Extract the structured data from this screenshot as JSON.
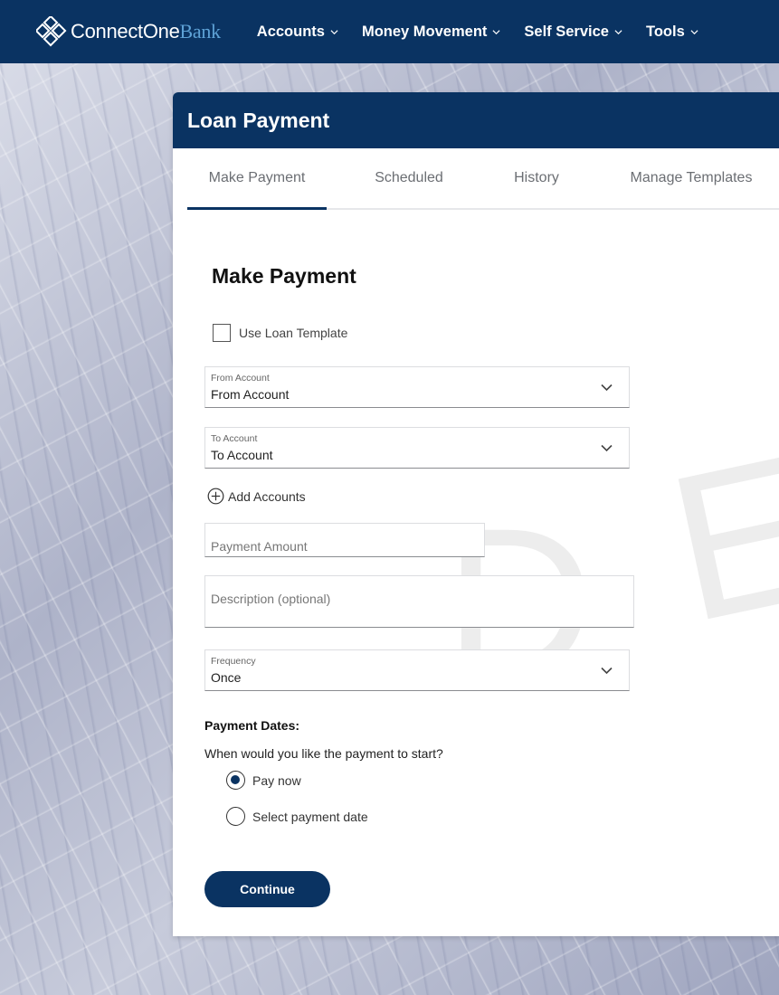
{
  "brand": {
    "name_part1": "ConnectOne",
    "name_part2": "Bank"
  },
  "nav": {
    "items": [
      {
        "label": "Accounts"
      },
      {
        "label": "Money Movement"
      },
      {
        "label": "Self Service"
      },
      {
        "label": "Tools"
      }
    ]
  },
  "card": {
    "title": "Loan Payment"
  },
  "tabs": [
    {
      "label": "Make Payment",
      "active": true
    },
    {
      "label": "Scheduled"
    },
    {
      "label": "History"
    },
    {
      "label": "Manage Templates"
    }
  ],
  "form": {
    "title": "Make Payment",
    "use_template_label": "Use Loan Template",
    "from_account": {
      "label": "From Account",
      "value": "From Account"
    },
    "to_account": {
      "label": "To Account",
      "value": "To Account"
    },
    "add_accounts_label": "Add Accounts",
    "payment_amount_placeholder": "Payment Amount",
    "description_placeholder": "Description (optional)",
    "frequency": {
      "label": "Frequency",
      "value": "Once"
    },
    "payment_dates_label": "Payment Dates:",
    "start_question": "When would you like the payment to start?",
    "radio_options": [
      {
        "label": "Pay now",
        "selected": true
      },
      {
        "label": "Select payment date",
        "selected": false
      }
    ],
    "continue_label": "Continue"
  },
  "colors": {
    "navy": "#0a3362",
    "brand_accent": "#5ea2d6"
  }
}
